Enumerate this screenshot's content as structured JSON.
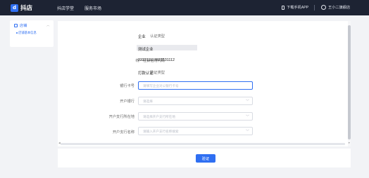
{
  "header": {
    "brand": "抖店",
    "brand_icon": "doudian-logo-icon",
    "nav": [
      "抖店学堂",
      "服务市场"
    ],
    "download_app": "下载手机APP",
    "user": "王小二旗舰店"
  },
  "sidebar": {
    "group": "店铺",
    "item": "店铺基本信息"
  },
  "form": {
    "cert_type": {
      "label": "认证类型",
      "value": "企业"
    },
    "company_name": {
      "label": "公司名称",
      "value": "测试企业"
    },
    "credit_code": {
      "label": "统一社会信用代码",
      "value": "222211117823531112"
    },
    "verify_type": {
      "label": "验证类型",
      "value": "打款认证"
    },
    "bank_card": {
      "label": "银行卡号",
      "placeholder": "请填写企业对公银行卡号"
    },
    "bank": {
      "label": "开户银行",
      "placeholder": "请选择"
    },
    "bank_region": {
      "label": "开户支行所在地",
      "placeholder": "请选择开户支行所在地"
    },
    "bank_branch": {
      "label": "开户支行名称",
      "placeholder": "请输入开户支行名称搜索"
    }
  },
  "actions": {
    "submit": "验证"
  },
  "colors": {
    "accent": "#2f6ff2",
    "topbar": "#1d2333",
    "background": "#f2f3f6"
  }
}
